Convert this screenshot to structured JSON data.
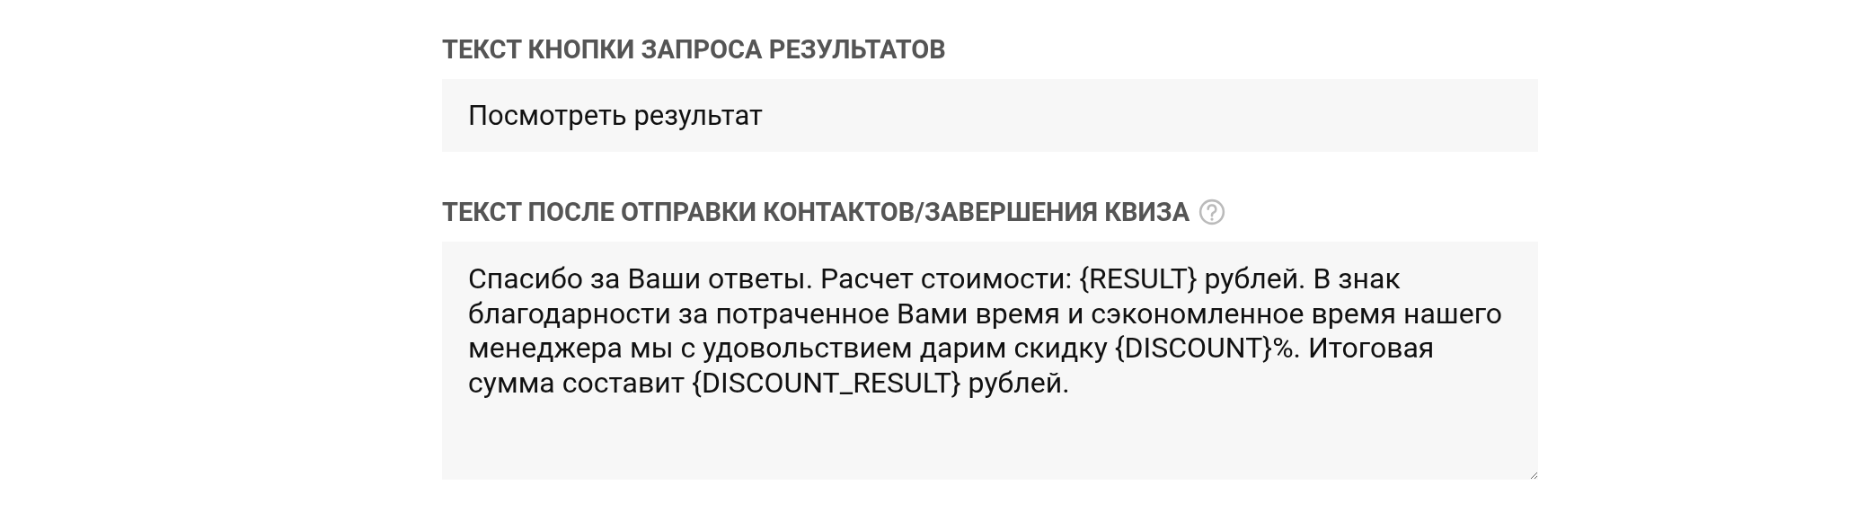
{
  "fields": [
    {
      "kind": "input",
      "label": "ТЕКСТ КНОПКИ ЗАПРОСА РЕЗУЛЬТАТОВ",
      "help": false,
      "value": "Посмотреть результат"
    },
    {
      "kind": "textarea",
      "label": "ТЕКСТ ПОСЛЕ ОТПРАВКИ КОНТАКТОВ/ЗАВЕРШЕНИЯ КВИЗА",
      "help": true,
      "value": "Спасибо за Ваши ответы. Расчет стоимости: {RESULT} рублей. В знак благодарности за потраченное Вами время и сэкономленное время нашего менеджера мы с удовольствием дарим скидку {DISCOUNT}%. Итоговая сумма составит {DISCOUNT_RESULT} рублей."
    }
  ]
}
